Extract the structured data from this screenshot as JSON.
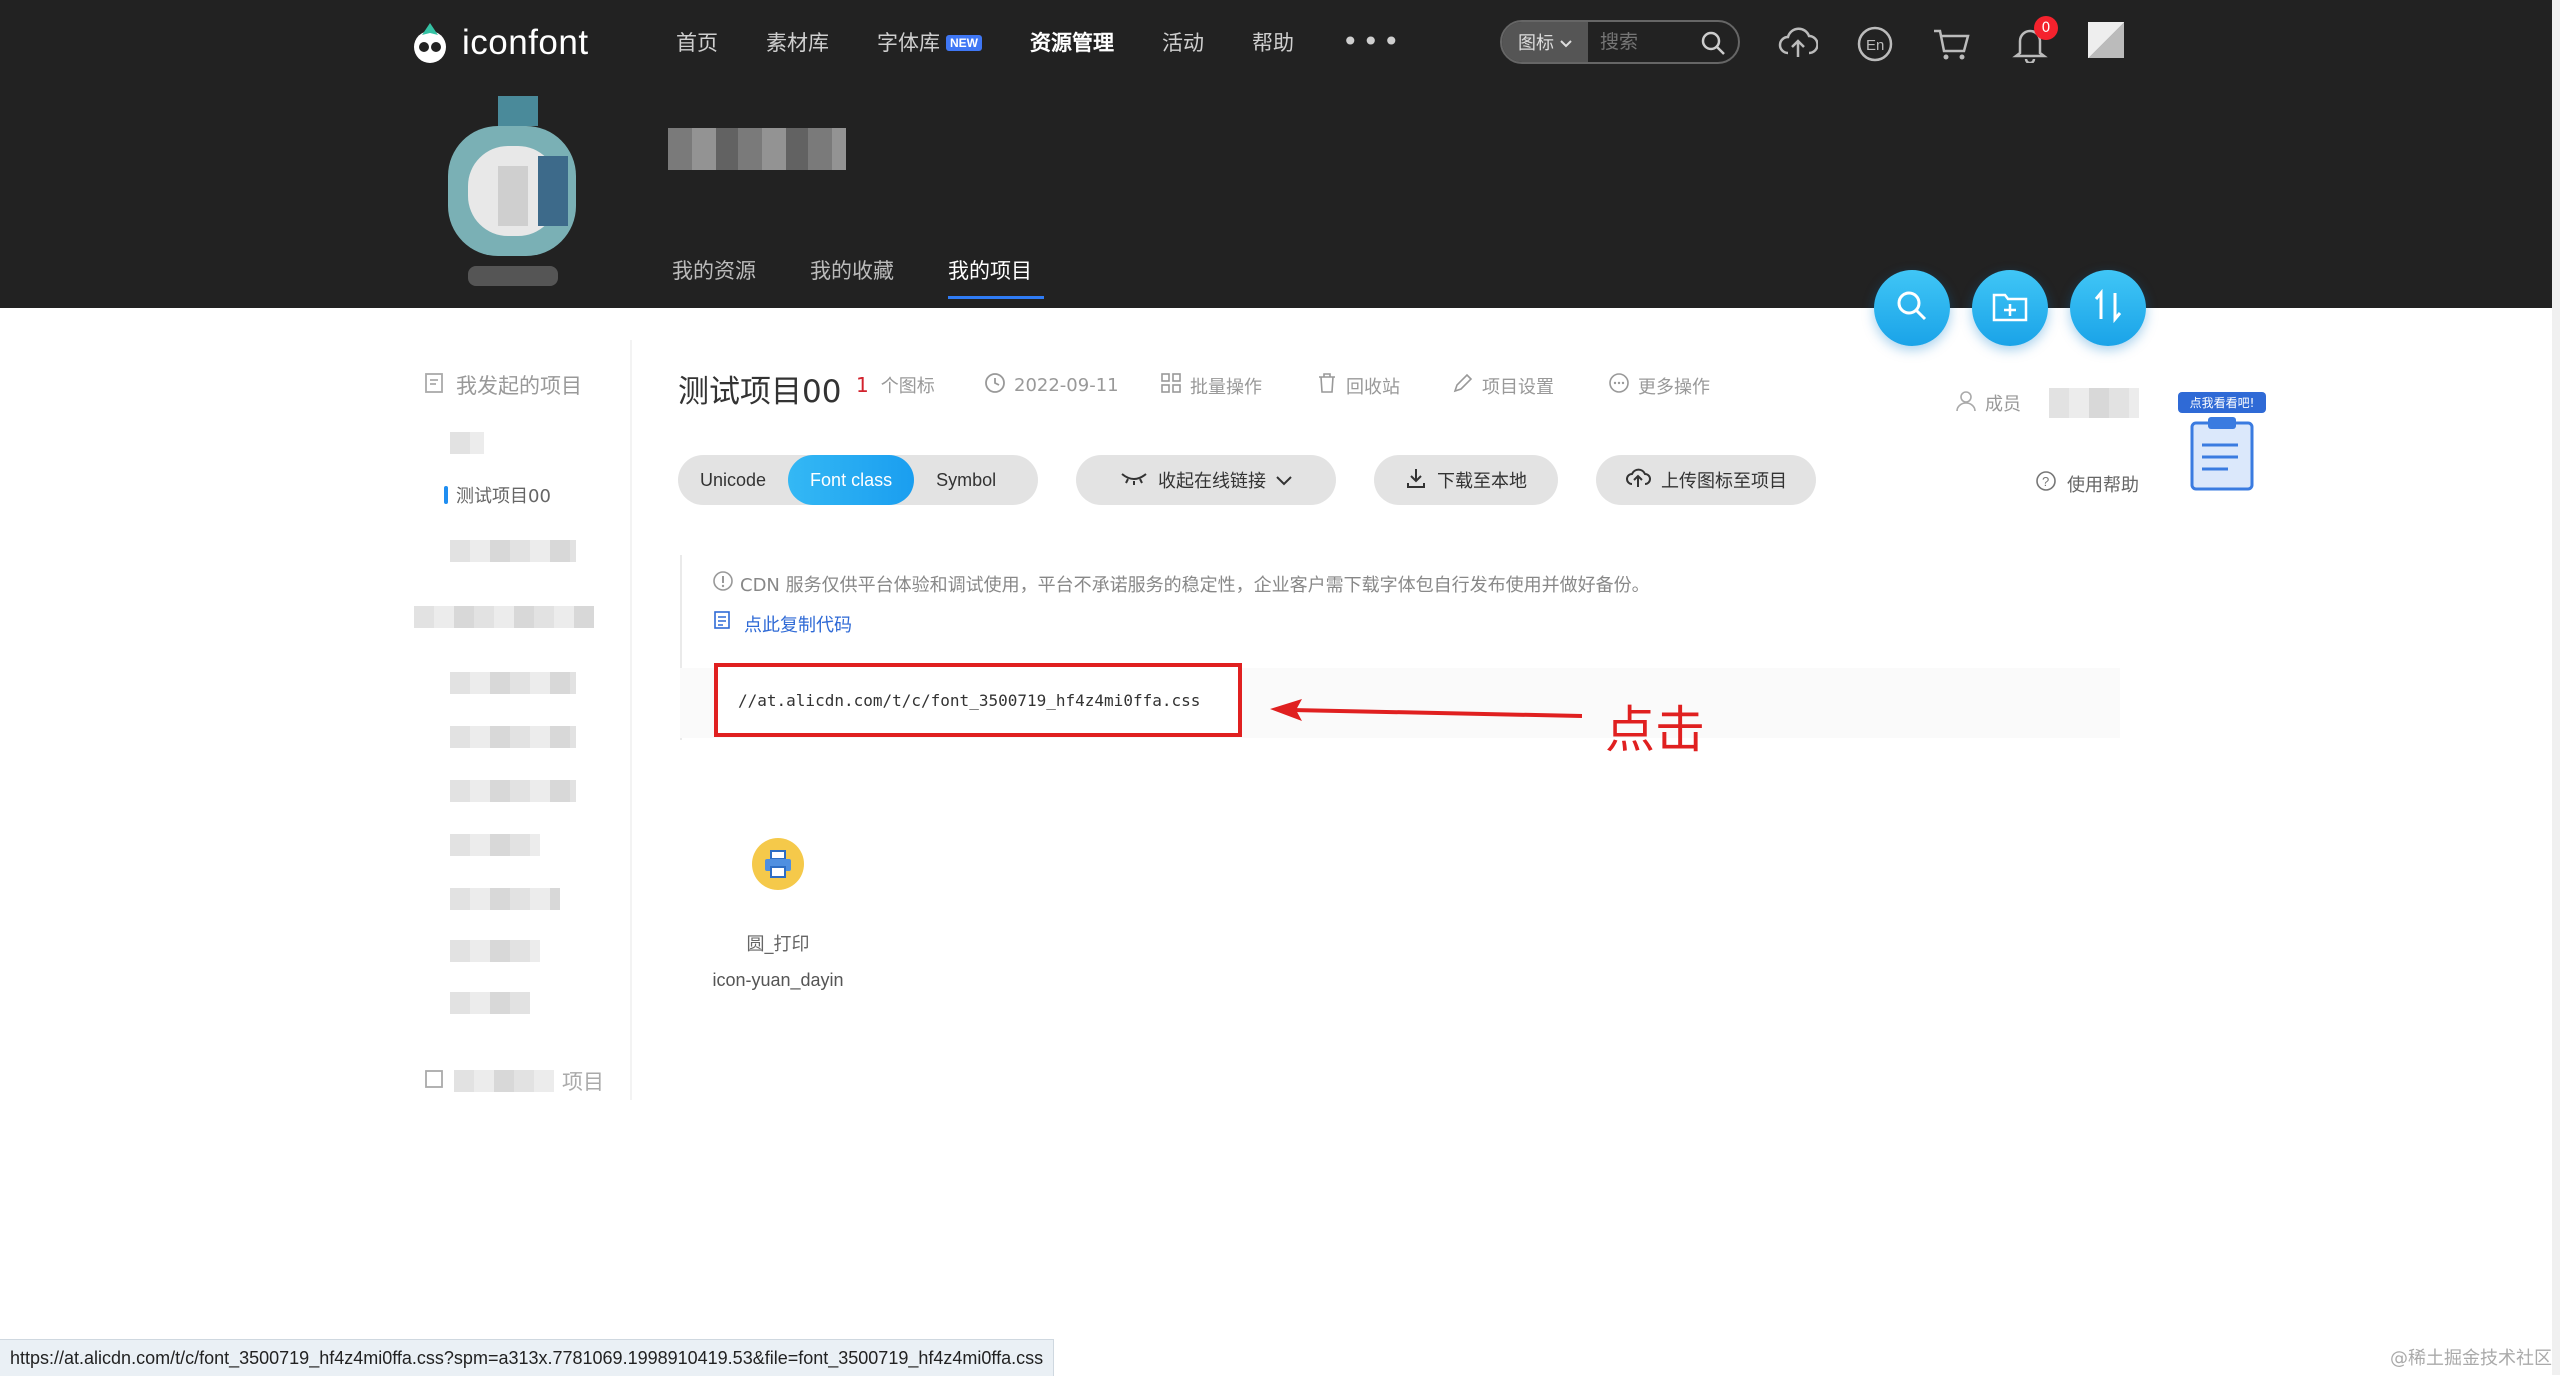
{
  "brand": {
    "name": "iconfont"
  },
  "nav": {
    "items": [
      {
        "label": "首页",
        "bold": false
      },
      {
        "label": "素材库",
        "bold": false
      },
      {
        "label": "字体库",
        "bold": false,
        "badge": "NEW"
      },
      {
        "label": "资源管理",
        "bold": true
      },
      {
        "label": "活动",
        "bold": false
      },
      {
        "label": "帮助",
        "bold": false
      }
    ],
    "more": "•••"
  },
  "search": {
    "type_label": "图标",
    "placeholder": "搜索"
  },
  "notifications": {
    "count": "0"
  },
  "profile_tabs": [
    "我的资源",
    "我的收藏",
    "我的项目"
  ],
  "sidebar": {
    "title": "我发起的项目",
    "active_item": "测试项目00",
    "footer": "项目"
  },
  "project": {
    "title": "测试项目00",
    "icon_count": "1",
    "icon_count_unit": "个图标",
    "date": "2022-09-11",
    "actions": [
      "批量操作",
      "回收站",
      "项目设置",
      "更多操作"
    ],
    "member_label": "成员"
  },
  "modes": [
    "Unicode",
    "Font class",
    "Symbol"
  ],
  "active_mode": "Font class",
  "buttons": {
    "collapse_link": "收起在线链接",
    "download": "下载至本地",
    "upload": "上传图标至项目",
    "help": "使用帮助"
  },
  "promo": {
    "label": "点我看看吧!"
  },
  "notice": "CDN 服务仅供平台体验和调试使用，平台不承诺服务的稳定性，企业客户需下载字体包自行发布使用并做好备份。",
  "copy_code": "点此复制代码",
  "cdn_link": "//at.alicdn.com/t/c/font_3500719_hf4z4mi0ffa.css",
  "annotation": "点击",
  "icons": [
    {
      "name": "圆_打印",
      "class": "icon-yuan_dayin"
    }
  ],
  "status_url": "https://at.alicdn.com/t/c/font_3500719_hf4z4mi0ffa.css?spm=a313x.7781069.1998910419.53&file=font_3500719_hf4z4mi0ffa.css",
  "watermark": "@稀土掘金技术社区",
  "colors": {
    "header_bg": "#222222",
    "accent": "#1a9ef0",
    "annotation_red": "#e02020"
  }
}
